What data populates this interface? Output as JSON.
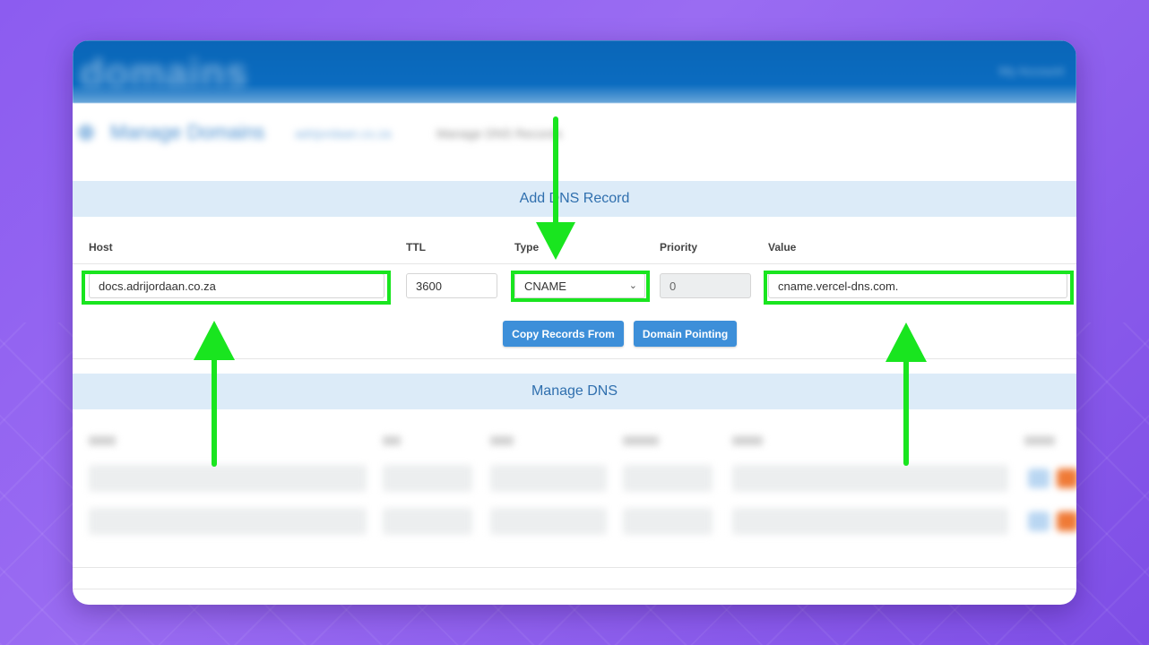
{
  "breadcrumb": {
    "title": "Manage Domains",
    "link": "adrijordaan.co.za",
    "current": "Manage DNS Records"
  },
  "brand": "domains",
  "top_right": "My Account",
  "add_section": {
    "title": "Add DNS Record",
    "columns": {
      "host": "Host",
      "ttl": "TTL",
      "type": "Type",
      "priority": "Priority",
      "value": "Value"
    },
    "fields": {
      "host": "docs.adrijordaan.co.za",
      "ttl": "3600",
      "type": "CNAME",
      "priority": "0",
      "value": "cname.vercel-dns.com."
    },
    "buttons": {
      "copy": "Copy Records From",
      "pointing": "Domain Pointing"
    }
  },
  "manage_section": {
    "title": "Manage DNS"
  },
  "colors": {
    "highlight": "#19e51f",
    "accent": "#3d8fd9",
    "header_bg": "#dcebf8"
  },
  "icons": {
    "select": "chevron-down-icon",
    "arrows": "arrow-icon"
  }
}
